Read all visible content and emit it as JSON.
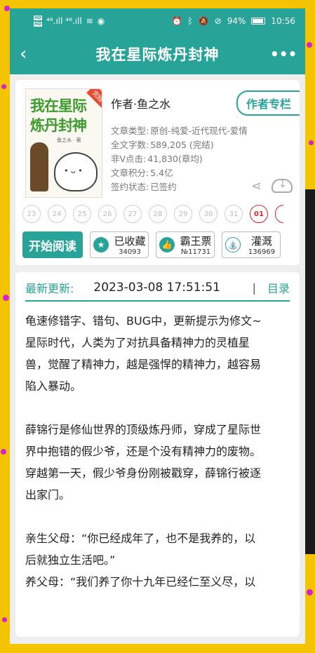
{
  "status": {
    "sim1": "HD",
    "sim2": "HD",
    "signal": "⁴⁶.ıll ⁴⁶.ıll",
    "battery": "94%",
    "time": "10:56"
  },
  "appbar": {
    "title": "我在星际炼丹封神",
    "back_icon": "‹",
    "more_icon": "•••"
  },
  "book": {
    "cover_title_1": "我在星际",
    "cover_title_2": "炼丹封神",
    "cover_author": "鱼之水 · 著",
    "cover_stamp": "完结",
    "author": "作者·鱼之水",
    "author_btn": "作者专栏",
    "meta": [
      {
        "k": "文章类型:",
        "v": "原创-纯爱-近代现代-爱情"
      },
      {
        "k": "全文字数:",
        "v": "589,205 (完结)"
      },
      {
        "k": "非Ⅴ点击:",
        "v": "41,830(章均)"
      },
      {
        "k": "文章积分:",
        "v": "5.4亿"
      },
      {
        "k": "签约状态:",
        "v": "已签约"
      }
    ]
  },
  "badges": [
    "23",
    "24",
    "25",
    "26",
    "27",
    "28",
    "29",
    "30",
    "31",
    "01"
  ],
  "actions": {
    "read": "开始阅读",
    "collect_label": "已收藏",
    "collect_count": "34093",
    "ticket_label": "霸王票",
    "ticket_count": "№11731",
    "water_label": "灌溉",
    "water_count": "136969"
  },
  "update": {
    "label": "最新更新:",
    "time": "2023-03-08 17:51:51",
    "sep": "|",
    "catalog": "目录"
  },
  "description": [
    "龟速修错字、错句、BUG中，更新提示为修文~",
    "星际时代，人类为了对抗具备精神力的灵植星",
    "兽，觉醒了精神力，越是强悍的精神力，越容易",
    "陷入暴动。",
    "",
    "薛锦行是修仙世界的顶级炼丹师，穿成了星际世",
    "界中抱错的假少爷，还是个没有精神力的废物。",
    "穿越第一天，假少爷身份刚被戳穿，薛锦行被逐",
    "出家门。",
    "",
    "亲生父母：“你已经成年了，也不是我养的，以",
    "后就独立生活吧。”",
    "养父母：“我们养了你十九年已经仁至义尽，以"
  ]
}
